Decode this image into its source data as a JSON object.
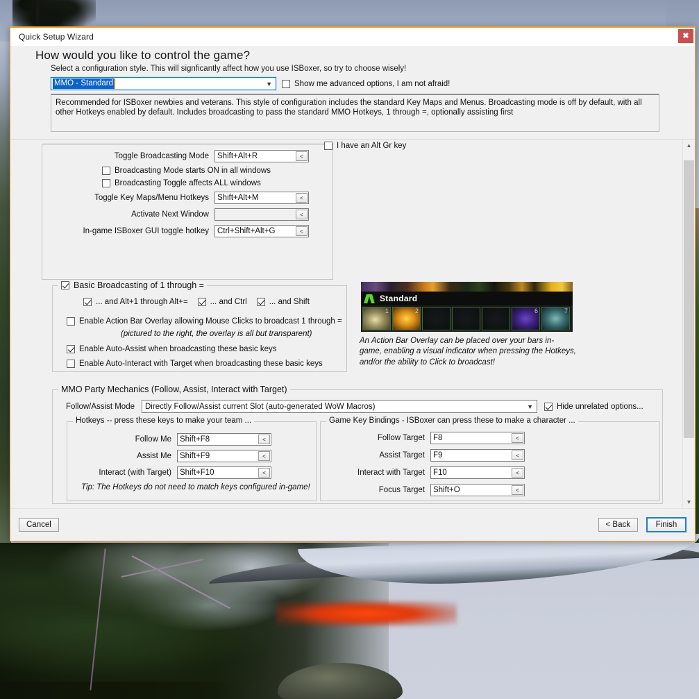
{
  "window": {
    "title": "Quick Setup Wizard",
    "close_label": "✖",
    "heading": "How would you like to control the game?",
    "subheading": "Select a configuration style. This will signficantly affect how you use ISBoxer, so try to choose wisely!",
    "style_selected": "MMO - Standard",
    "advanced_checkbox": "Show me advanced options, I am not afraid!",
    "advanced_checked": false,
    "description": "Recommended for ISBoxer newbies and veterans. This style of configuration includes the standard Key Maps and Menus. Broadcasting mode is off by default, with all other Hotkeys enabled by default. Includes broadcasting to pass the standard MMO Hotkeys, 1 through =, optionally assisting first"
  },
  "hotkeys_panel": {
    "rows": [
      {
        "label": "Toggle Broadcasting Mode",
        "value": "Shift+Alt+R",
        "button": "<"
      },
      {
        "label": "Toggle Key Maps/Menu Hotkeys",
        "value": "Shift+Alt+M",
        "button": "<"
      },
      {
        "label": "Activate Next Window",
        "value": "",
        "button": "<"
      },
      {
        "label": "In-game ISBoxer GUI toggle hotkey",
        "value": "Ctrl+Shift+Alt+G",
        "button": "<"
      }
    ],
    "check_starts_on": "Broadcasting Mode starts ON in all windows",
    "check_starts_on_checked": false,
    "check_affects_all": "Broadcasting Toggle affects ALL windows",
    "check_affects_all_checked": false,
    "altgr_label": "I have an Alt Gr key",
    "altgr_checked": false
  },
  "basic_broadcasting": {
    "title": "Basic Broadcasting of 1 through =",
    "title_checked": true,
    "modifiers": [
      {
        "label": "... and Alt+1 through Alt+=",
        "checked": true
      },
      {
        "label": "... and Ctrl",
        "checked": true
      },
      {
        "label": "... and Shift",
        "checked": true
      }
    ],
    "overlay_label": "Enable Action Bar Overlay allowing Mouse Clicks to broadcast 1 through =",
    "overlay_checked": false,
    "overlay_note": "(pictured to the right, the overlay is all but transparent)",
    "auto_assist_label": "Enable Auto-Assist when broadcasting these basic keys",
    "auto_assist_checked": true,
    "auto_interact_label": "Enable Auto-Interact with Target when broadcasting these basic keys",
    "auto_interact_checked": false
  },
  "preview": {
    "overlay_name": "Standard",
    "slots": [
      "1",
      "2",
      "",
      "",
      "",
      "6",
      "7"
    ],
    "caption": "An Action Bar Overlay can be placed over your bars in-game, enabling a visual indicator when pressing the Hotkeys, and/or the ability to Click to broadcast!"
  },
  "party_mechanics": {
    "title": "MMO Party Mechanics (Follow, Assist, Interact with Target)",
    "mode_label": "Follow/Assist Mode",
    "mode_value": "Directly Follow/Assist current Slot (auto-generated WoW Macros)",
    "hide_unrelated_label": "Hide unrelated options...",
    "hide_unrelated_checked": true,
    "hotkeys_group_title": "Hotkeys -- press these keys to make your team ...",
    "hotkeys_rows": [
      {
        "label": "Follow Me",
        "value": "Shift+F8",
        "button": "<"
      },
      {
        "label": "Assist Me",
        "value": "Shift+F9",
        "button": "<"
      },
      {
        "label": "Interact (with Target)",
        "value": "Shift+F10",
        "button": "<"
      }
    ],
    "tip": "Tip: The Hotkeys do not need to match keys configured in-game!",
    "bindings_group_title": "Game Key Bindings - ISBoxer can press these to make a character ...",
    "bindings_rows": [
      {
        "label": "Follow Target",
        "value": "F8",
        "button": "<"
      },
      {
        "label": "Assist Target",
        "value": "F9",
        "button": "<"
      },
      {
        "label": "Interact with Target",
        "value": "F10",
        "button": "<"
      },
      {
        "label": "Focus Target",
        "value": "Shift+O",
        "button": "<"
      }
    ]
  },
  "scrollbar": {
    "up": "▲",
    "down": "▼"
  },
  "footer": {
    "cancel": "Cancel",
    "back": "< Back",
    "finish": "Finish"
  },
  "colors": {
    "accent": "#0078d7",
    "window_border": "#f0a030",
    "close_bg": "#c8504e",
    "selection": "#0a63c9",
    "overlay_green": "#5dd62c"
  }
}
